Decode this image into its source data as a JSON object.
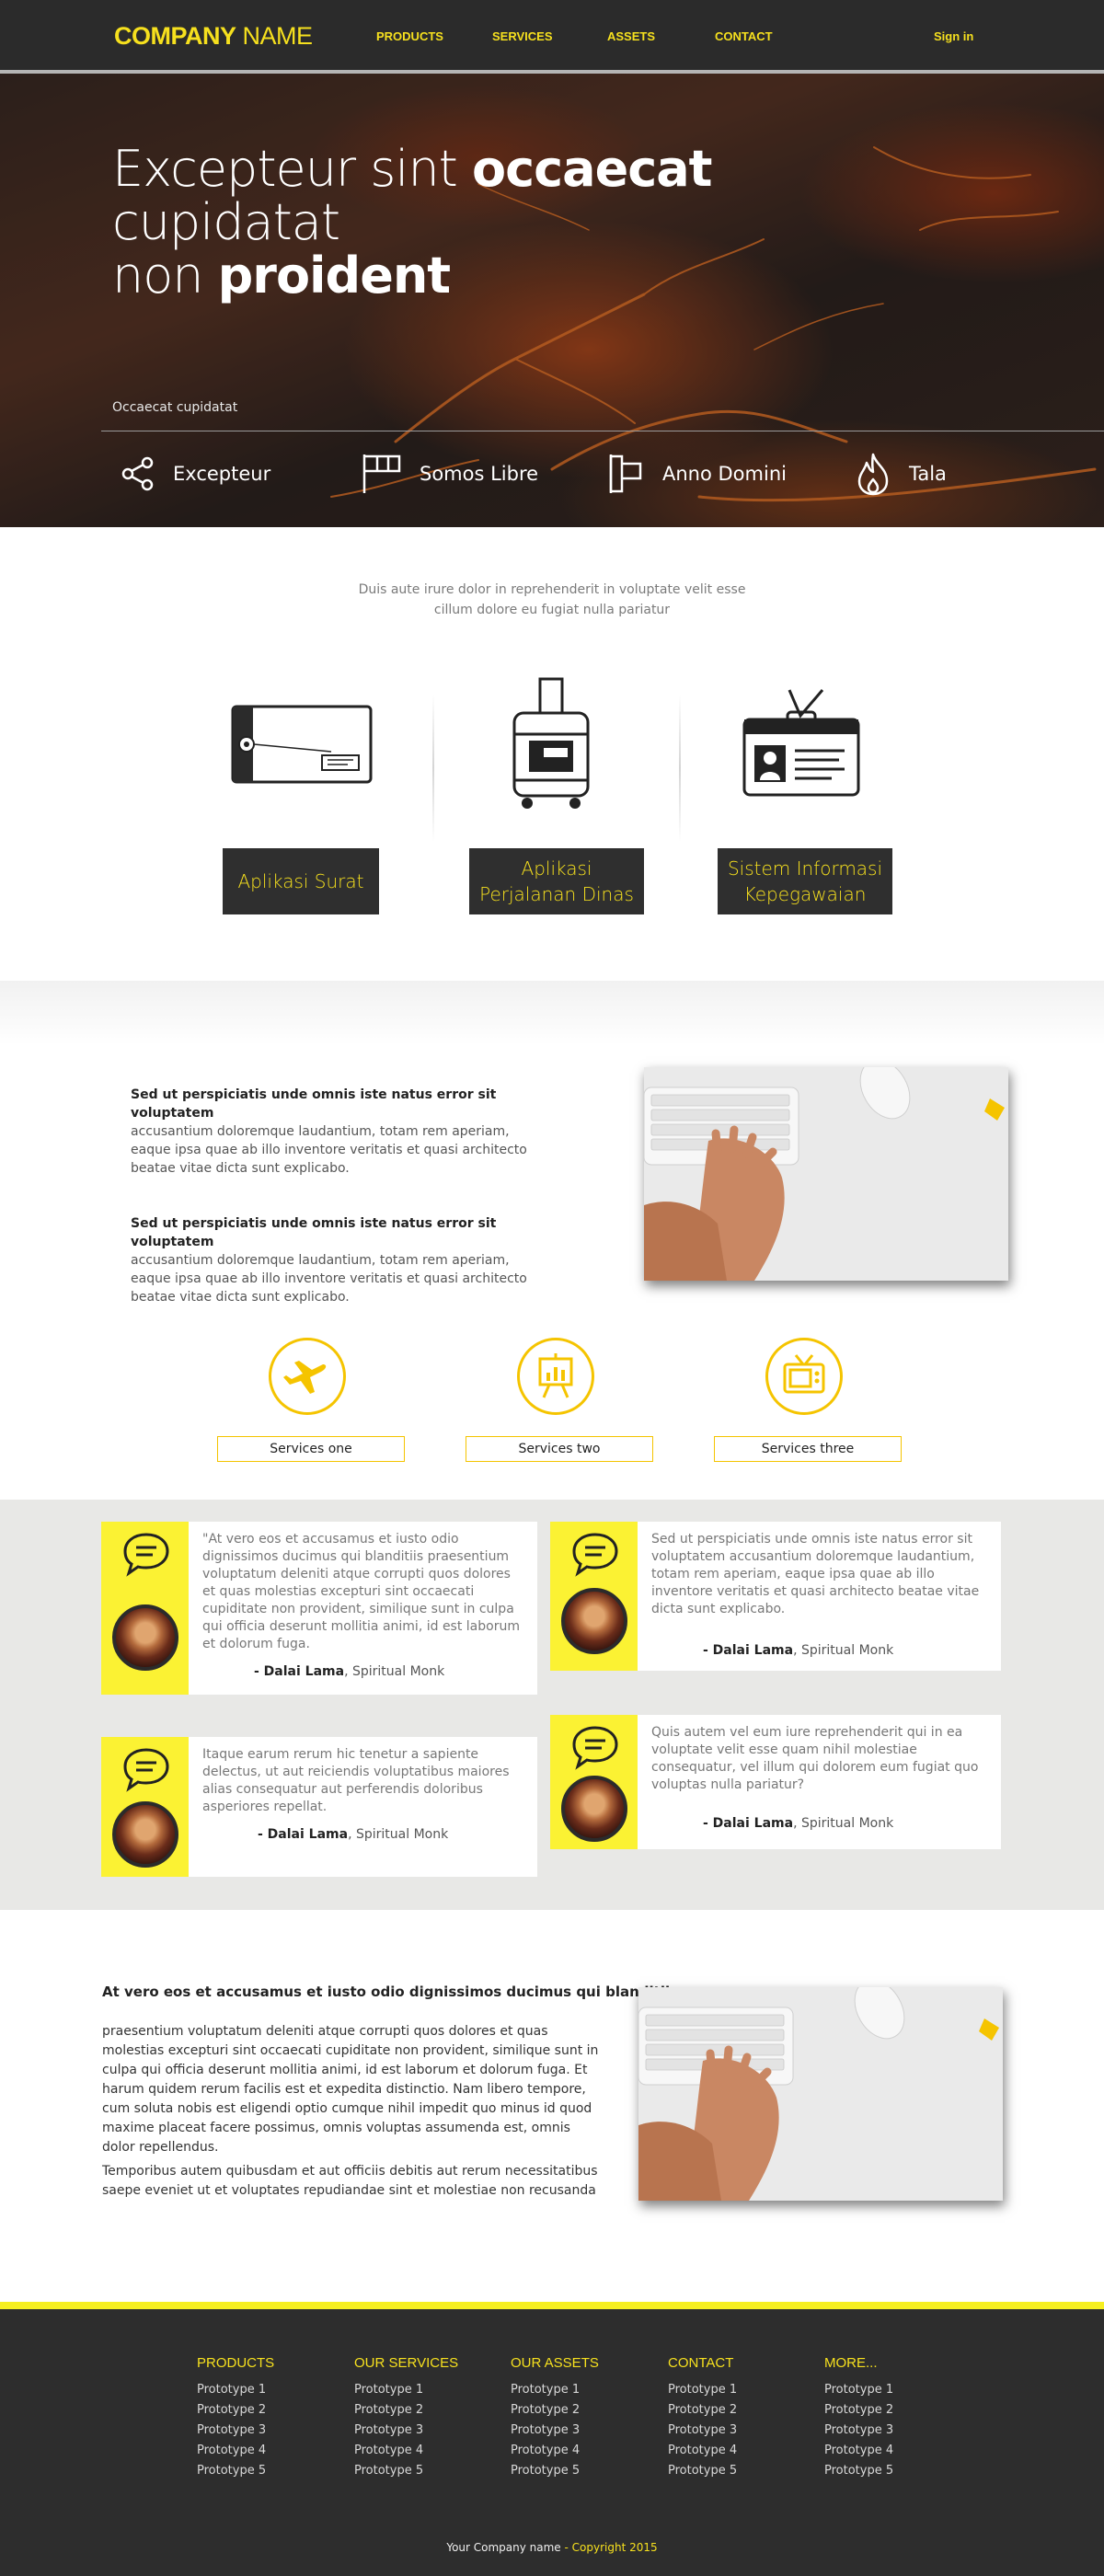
{
  "nav": {
    "logo_bold": "COMPANY",
    "logo_light": " NAME",
    "items": [
      "PRODUCTS",
      "SERVICES",
      "ASSETS",
      "CONTACT"
    ],
    "signin": "Sign in"
  },
  "hero": {
    "title_1": "Excepteur sint ",
    "title_bold_1": "occaecat",
    "title_2": " cupidatat",
    "title_3": "non ",
    "title_bold_2": "proident",
    "subtitle": "Occaecat cupidatat",
    "features": [
      {
        "label": "Excepteur",
        "icon": "share-icon"
      },
      {
        "label": "Somos Libre",
        "icon": "flag-icon"
      },
      {
        "label": "Anno Domini",
        "icon": "banner-icon"
      },
      {
        "label": "Tala",
        "icon": "fire-icon"
      }
    ]
  },
  "intro": {
    "text": "Duis aute irure dolor in reprehenderit in voluptate velit esse cillum dolore eu fugiat nulla pariatur",
    "apps": [
      "Aplikasi Surat",
      "Aplikasi Perjalanan Dinas",
      "Sistem Informasi Kepegawaian"
    ]
  },
  "features": {
    "para_1_title": "Sed ut perspiciatis unde omnis iste natus error sit voluptatem",
    "para_1_body": "accusantium doloremque laudantium, totam rem aperiam, eaque ipsa quae ab illo inventore veritatis et quasi architecto beatae vitae dicta sunt explicabo.",
    "para_2_title": "Sed ut perspiciatis unde omnis iste natus error sit voluptatem",
    "para_2_body": "accusantium doloremque laudantium, totam rem aperiam, eaque ipsa quae ab illo inventore veritatis et quasi architecto beatae vitae dicta sunt explicabo.",
    "services": [
      "Services one",
      "Services two",
      "Services three"
    ]
  },
  "testimonials": [
    {
      "quote": "\"At vero eos et accusamus et iusto odio dignissimos ducimus qui blanditiis praesentium voluptatum deleniti atque corrupti quos dolores et quas molestias excepturi sint occaecati cupiditate non provident, similique sunt in culpa qui officia deserunt mollitia animi, id est laborum et dolorum fuga.",
      "name": "- Dalai Lama",
      "role": ", Spiritual Monk"
    },
    {
      "quote": "Sed ut perspiciatis unde omnis iste natus error sit voluptatem accusantium doloremque laudantium, totam rem aperiam, eaque ipsa quae ab illo inventore veritatis et quasi architecto beatae vitae dicta sunt explicabo.",
      "name": "- Dalai Lama",
      "role": ", Spiritual Monk"
    },
    {
      "quote": "Itaque earum rerum hic tenetur a sapiente delectus, ut aut reiciendis voluptatibus maiores alias consequatur aut perferendis doloribus asperiores repellat.",
      "name": "- Dalai Lama",
      "role": ", Spiritual Monk"
    },
    {
      "quote": "Quis autem vel eum iure reprehenderit qui in ea voluptate velit esse quam nihil molestiae consequatur, vel illum qui dolorem eum fugiat quo voluptas nulla pariatur?",
      "name": "- Dalai Lama",
      "role": ", Spiritual Monk"
    }
  ],
  "bottom": {
    "heading": "At vero eos et accusamus et iusto odio dignissimos ducimus qui blanditiis",
    "para_1": "praesentium voluptatum deleniti atque corrupti quos dolores et quas molestias excepturi sint occaecati cupiditate non provident, similique sunt in culpa qui officia deserunt mollitia animi, id est laborum et dolorum fuga. Et harum quidem rerum facilis est et expedita distinctio. Nam libero tempore, cum soluta nobis est eligendi optio cumque nihil impedit quo minus id quod maxime placeat facere possimus, omnis voluptas assumenda est, omnis dolor repellendus.",
    "para_2": "Temporibus autem quibusdam et aut officiis debitis aut rerum necessitatibus saepe eveniet ut et voluptates repudiandae sint et molestiae non recusanda"
  },
  "footer": {
    "columns": [
      {
        "title": "PRODUCTS",
        "items": [
          "Prototype 1",
          "Prototype 2",
          "Prototype 3",
          "Prototype 4",
          "Prototype 5"
        ]
      },
      {
        "title": "OUR SERVICES",
        "items": [
          "Prototype 1",
          "Prototype 2",
          "Prototype 3",
          "Prototype 4",
          "Prototype 5"
        ]
      },
      {
        "title": "OUR ASSETS",
        "items": [
          "Prototype 1",
          "Prototype 2",
          "Prototype 3",
          "Prototype 4",
          "Prototype 5"
        ]
      },
      {
        "title": "CONTACT",
        "items": [
          "Prototype 1",
          "Prototype 2",
          "Prototype 3",
          "Prototype 4",
          "Prototype 5"
        ]
      },
      {
        "title": "MORE...",
        "items": [
          "Prototype 1",
          "Prototype 2",
          "Prototype 3",
          "Prototype 4",
          "Prototype 5"
        ]
      }
    ],
    "copyright_name": "Your Company name",
    "copyright_sep": " - ",
    "copyright_year": "Copyright 2015"
  },
  "colors": {
    "accent": "#f6e01e",
    "dark": "#2b2b2b",
    "testimonial_yellow": "#fbf233"
  }
}
